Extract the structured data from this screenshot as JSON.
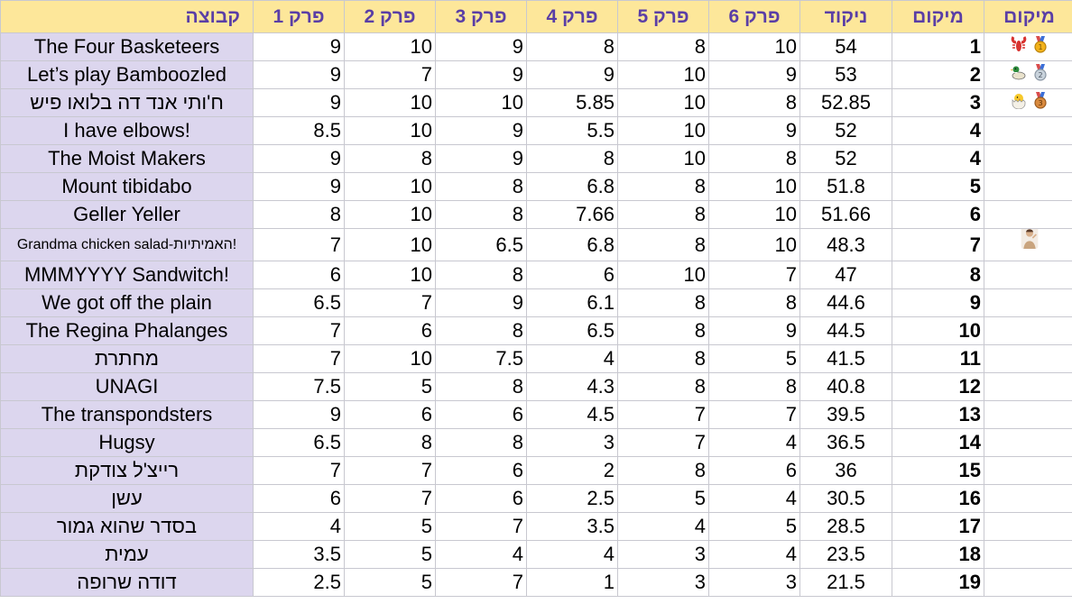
{
  "headers": {
    "team": "קבוצה",
    "r1": "פרק 1",
    "r2": "פרק 2",
    "r3": "פרק 3",
    "r4": "פרק 4",
    "r5": "פרק 5",
    "r6": "פרק 6",
    "score": "ניקוד",
    "rank": "מיקום",
    "medal": "מיקום"
  },
  "colors": {
    "header_bg": "#fde79a",
    "header_text": "#5a3ea6",
    "team_bg": "#dcd6ee"
  },
  "rows": [
    {
      "team": "The Four Basketeers",
      "r1": "9",
      "r2": "10",
      "r3": "9",
      "r4": "8",
      "r5": "8",
      "r6": "10",
      "score": "54",
      "rank": "1",
      "icons": [
        "gold-medal-icon",
        "lobster-icon"
      ]
    },
    {
      "team": "Let’s play Bamboozled",
      "r1": "9",
      "r2": "7",
      "r3": "9",
      "r4": "9",
      "r5": "10",
      "r6": "9",
      "score": "53",
      "rank": "2",
      "icons": [
        "silver-medal-icon",
        "duck-icon"
      ]
    },
    {
      "team": "ח'ותי אנד דה בלואו פיש",
      "r1": "9",
      "r2": "10",
      "r3": "10",
      "r4": "5.85",
      "r5": "10",
      "r6": "8",
      "score": "52.85",
      "rank": "3",
      "icons": [
        "bronze-medal-icon",
        "hatching-chick-icon"
      ]
    },
    {
      "team": "I have elbows!",
      "r1": "8.5",
      "r2": "10",
      "r3": "9",
      "r4": "5.5",
      "r5": "10",
      "r6": "9",
      "score": "52",
      "rank": "4",
      "icons": []
    },
    {
      "team": "The Moist Makers",
      "r1": "9",
      "r2": "8",
      "r3": "9",
      "r4": "8",
      "r5": "10",
      "r6": "8",
      "score": "52",
      "rank": "4",
      "icons": []
    },
    {
      "team": "Mount tibidabo",
      "r1": "9",
      "r2": "10",
      "r3": "8",
      "r4": "6.8",
      "r5": "8",
      "r6": "10",
      "score": "51.8",
      "rank": "5",
      "icons": []
    },
    {
      "team": "Geller Yeller",
      "r1": "8",
      "r2": "10",
      "r3": "8",
      "r4": "7.66",
      "r5": "8",
      "r6": "10",
      "score": "51.66",
      "rank": "6",
      "icons": []
    },
    {
      "team": "Grandma chicken salad-האמיתיות!",
      "r1": "7",
      "r2": "10",
      "r3": "6.5",
      "r4": "6.8",
      "r5": "8",
      "r6": "10",
      "score": "48.3",
      "rank": "7",
      "icons": [
        "person-sticker-icon"
      ]
    },
    {
      "team": "MMMYYYY Sandwitch!",
      "r1": "6",
      "r2": "10",
      "r3": "8",
      "r4": "6",
      "r5": "10",
      "r6": "7",
      "score": "47",
      "rank": "8",
      "icons": []
    },
    {
      "team": "We got off the plain",
      "r1": "6.5",
      "r2": "7",
      "r3": "9",
      "r4": "6.1",
      "r5": "8",
      "r6": "8",
      "score": "44.6",
      "rank": "9",
      "icons": []
    },
    {
      "team": "The Regina Phalanges",
      "r1": "7",
      "r2": "6",
      "r3": "8",
      "r4": "6.5",
      "r5": "8",
      "r6": "9",
      "score": "44.5",
      "rank": "10",
      "icons": []
    },
    {
      "team": "מחתרת",
      "r1": "7",
      "r2": "10",
      "r3": "7.5",
      "r4": "4",
      "r5": "8",
      "r6": "5",
      "score": "41.5",
      "rank": "11",
      "icons": []
    },
    {
      "team": "UNAGI",
      "r1": "7.5",
      "r2": "5",
      "r3": "8",
      "r4": "4.3",
      "r5": "8",
      "r6": "8",
      "score": "40.8",
      "rank": "12",
      "icons": []
    },
    {
      "team": "The transpondsters",
      "r1": "9",
      "r2": "6",
      "r3": "6",
      "r4": "4.5",
      "r5": "7",
      "r6": "7",
      "score": "39.5",
      "rank": "13",
      "icons": []
    },
    {
      "team": "Hugsy",
      "r1": "6.5",
      "r2": "8",
      "r3": "8",
      "r4": "3",
      "r5": "7",
      "r6": "4",
      "score": "36.5",
      "rank": "14",
      "icons": []
    },
    {
      "team": "רייצ'ל צודקת",
      "r1": "7",
      "r2": "7",
      "r3": "6",
      "r4": "2",
      "r5": "8",
      "r6": "6",
      "score": "36",
      "rank": "15",
      "icons": []
    },
    {
      "team": "עשן",
      "r1": "6",
      "r2": "7",
      "r3": "6",
      "r4": "2.5",
      "r5": "5",
      "r6": "4",
      "score": "30.5",
      "rank": "16",
      "icons": []
    },
    {
      "team": "בסדר שהוא גמור",
      "r1": "4",
      "r2": "5",
      "r3": "7",
      "r4": "3.5",
      "r5": "4",
      "r6": "5",
      "score": "28.5",
      "rank": "17",
      "icons": []
    },
    {
      "team": "עמית",
      "r1": "3.5",
      "r2": "5",
      "r3": "4",
      "r4": "4",
      "r5": "3",
      "r6": "4",
      "score": "23.5",
      "rank": "18",
      "icons": []
    },
    {
      "team": "דודה שרופה",
      "r1": "2.5",
      "r2": "5",
      "r3": "7",
      "r4": "1",
      "r5": "3",
      "r6": "3",
      "score": "21.5",
      "rank": "19",
      "icons": []
    }
  ]
}
